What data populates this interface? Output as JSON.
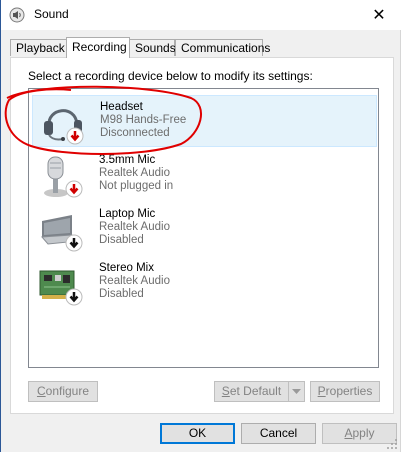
{
  "window": {
    "title": "Sound",
    "close_glyph": "✕"
  },
  "tabs": [
    {
      "label": "Playback",
      "active": false
    },
    {
      "label": "Recording",
      "active": true
    },
    {
      "label": "Sounds",
      "active": false
    },
    {
      "label": "Communications",
      "active": false
    }
  ],
  "instruction": "Select a recording device below to modify its settings:",
  "devices": [
    {
      "name": "Headset",
      "driver": "M98 Hands-Free",
      "status": "Disconnected",
      "icon": "headset-icon",
      "badge": "red-down-arrow",
      "selected": true
    },
    {
      "name": "3.5mm Mic",
      "driver": "Realtek Audio",
      "status": "Not plugged in",
      "icon": "microphone-icon",
      "badge": "red-down-arrow",
      "selected": false
    },
    {
      "name": "Laptop Mic",
      "driver": "Realtek Audio",
      "status": "Disabled",
      "icon": "laptop-microphone-icon",
      "badge": "black-down-arrow",
      "selected": false
    },
    {
      "name": "Stereo Mix",
      "driver": "Realtek Audio",
      "status": "Disabled",
      "icon": "sound-card-icon",
      "badge": "black-down-arrow",
      "selected": false
    }
  ],
  "buttons": {
    "configure_prefix": "",
    "configure_ul": "C",
    "configure_rest": "onfigure",
    "setdefault_ul": "S",
    "setdefault_rest": "et Default",
    "properties_ul": "P",
    "properties_rest": "roperties",
    "ok": "OK",
    "cancel": "Cancel",
    "apply_ul": "A",
    "apply_rest": "pply"
  },
  "colors": {
    "accent": "#0078d7",
    "selected_bg": "#e5f3fb",
    "annotation": "#e00000"
  }
}
